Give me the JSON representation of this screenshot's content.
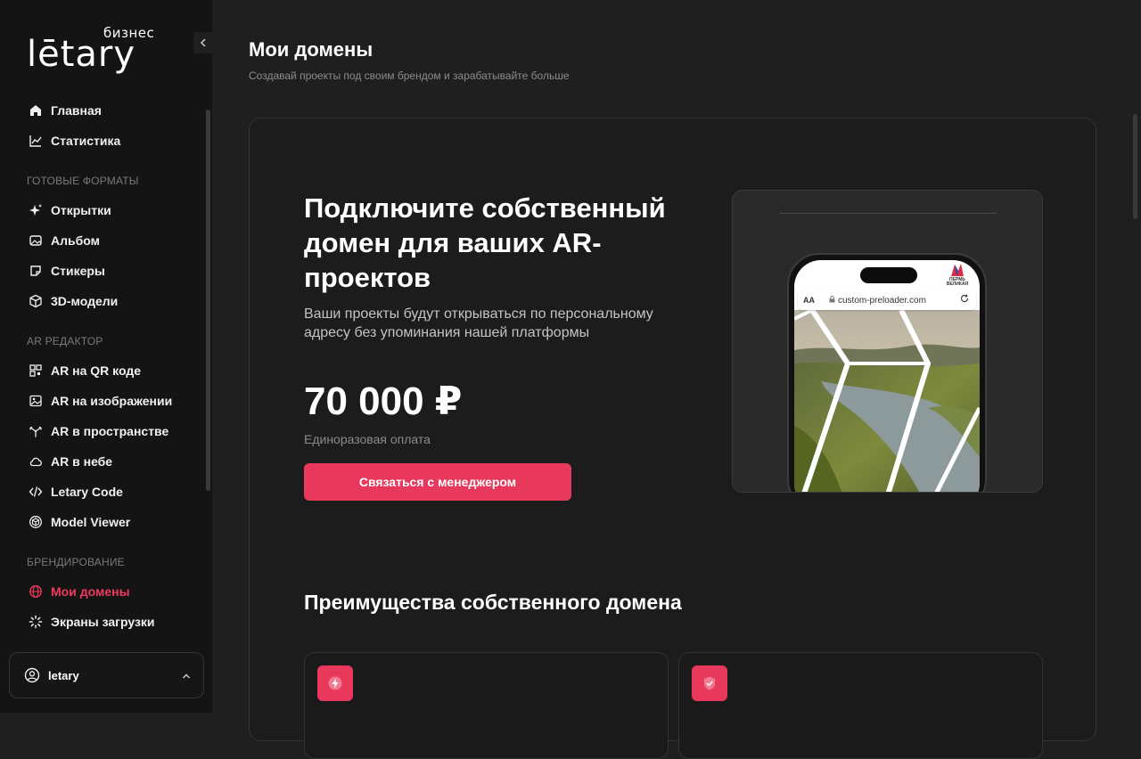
{
  "brand": {
    "word": "lētary",
    "tag": "бизнес"
  },
  "sidebar": {
    "items_top": [
      {
        "label": "Главная",
        "icon": "home-icon"
      },
      {
        "label": "Статистика",
        "icon": "chart-icon"
      }
    ],
    "section_formats": "ГОТОВЫЕ ФОРМАТЫ",
    "items_formats": [
      {
        "label": "Открытки",
        "icon": "sparkle-icon"
      },
      {
        "label": "Альбом",
        "icon": "album-icon"
      },
      {
        "label": "Стикеры",
        "icon": "sticker-icon"
      },
      {
        "label": "3D-модели",
        "icon": "cube-icon"
      }
    ],
    "section_ar": "AR РЕДАКТОР",
    "items_ar": [
      {
        "label": "AR на QR коде",
        "icon": "qr-icon"
      },
      {
        "label": "AR на изображении",
        "icon": "image-icon"
      },
      {
        "label": "AR в пространстве",
        "icon": "space-icon"
      },
      {
        "label": "AR в небе",
        "icon": "cloud-icon"
      },
      {
        "label": "Letary Code",
        "icon": "code-icon"
      },
      {
        "label": "Model Viewer",
        "icon": "model-viewer-icon"
      }
    ],
    "section_branding": "БРЕНДИРОВАНИЕ",
    "items_branding": [
      {
        "label": "Мои домены",
        "icon": "globe-icon",
        "active": true
      },
      {
        "label": "Экраны загрузки",
        "icon": "loader-icon"
      }
    ],
    "user": {
      "name": "letary"
    }
  },
  "page": {
    "title": "Мои домены",
    "subtitle": "Создавай проекты под своим брендом и зарабатывайте больше"
  },
  "hero": {
    "title": "Подключите собственный домен для ваших AR-проектов",
    "description": "Ваши проекты будут открываться по персональному адресу без упоминания нашей платформы",
    "price": "70 000 ₽",
    "price_note": "Единоразовая оплата",
    "cta_label": "Связаться с менеджером"
  },
  "preview": {
    "url": "custom-preloader.com",
    "aa": "AA",
    "logo_text": "ПЕРМЬ ВЕЛИКАЯ"
  },
  "benefits": {
    "title": "Преимущества собственного домена",
    "cards": [
      {
        "icon": "lightning-icon"
      },
      {
        "icon": "shield-check-icon"
      }
    ]
  },
  "colors": {
    "accent": "#e8385c",
    "background": "#1f1f1f",
    "sidebar": "#141414"
  }
}
